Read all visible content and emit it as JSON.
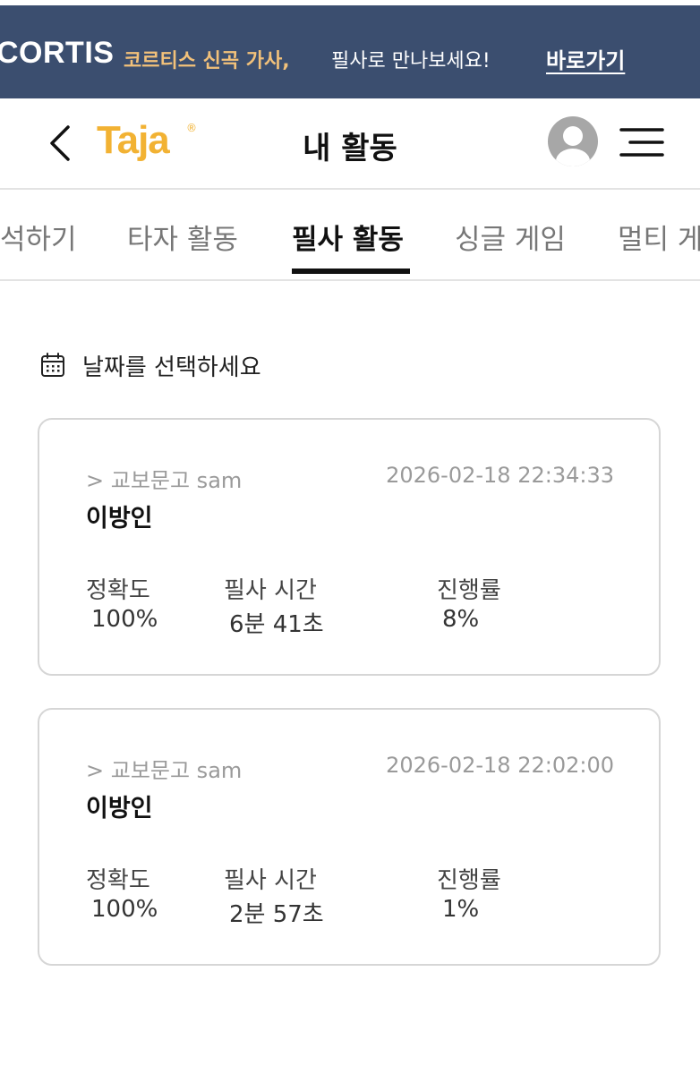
{
  "banner": {
    "brand": "CORTIS",
    "highlight": "코르티스 신곡 가사,",
    "text": "필사로 만나보세요!",
    "link": "바로가기"
  },
  "header": {
    "logo": "Taja",
    "logo_mark": "®",
    "title": "내 활동",
    "back_icon": "chevron-left-icon",
    "menu_icon": "hamburger-menu-icon",
    "avatar_icon": "user-avatar-icon"
  },
  "tabs": [
    {
      "label": "석하기",
      "active": false
    },
    {
      "label": "타자 활동",
      "active": false
    },
    {
      "label": "필사 활동",
      "active": true
    },
    {
      "label": "싱글 게임",
      "active": false
    },
    {
      "label": "멀티 게",
      "active": false
    }
  ],
  "date_picker": {
    "label": "날짜를 선택하세요",
    "icon": "calendar-icon"
  },
  "stat_labels": {
    "accuracy": "정확도",
    "time": "필사 시간",
    "progress": "진행률"
  },
  "records": [
    {
      "source": "> 교보문고 sam",
      "datetime": "2026-02-18 22:34:33",
      "title": "이방인",
      "accuracy": "100%",
      "time": "6분 41초",
      "progress": "8%"
    },
    {
      "source": "> 교보문고 sam",
      "datetime": "2026-02-18 22:02:00",
      "title": "이방인",
      "accuracy": "100%",
      "time": "2분 57초",
      "progress": "1%"
    }
  ],
  "colors": {
    "banner_bg": "#3b4e6f",
    "banner_highlight": "#f2c17a",
    "logo": "#f2b233",
    "card_border": "#d6d6d6"
  }
}
